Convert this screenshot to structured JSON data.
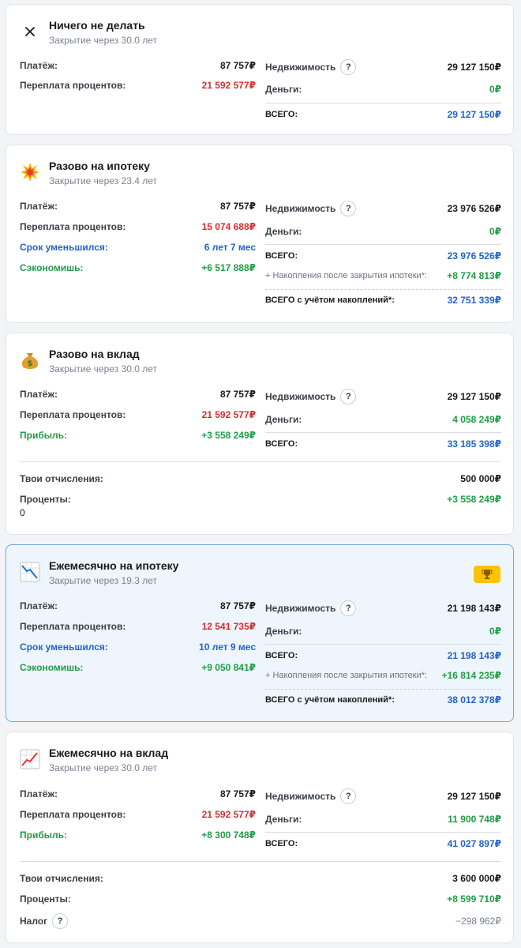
{
  "labels": {
    "payment": "Платёж:",
    "overpay": "Переплата процентов:",
    "term_reduced": "Срок уменьшился:",
    "saved": "Сэкономишь:",
    "profit": "Прибыль:",
    "realty": "Недвижимость",
    "money": "Деньги:",
    "total": "ВСЕГО:",
    "accum": "+ Накопления после закрытия ипотеки*:",
    "total_accum": "ВСЕГО с учётом накоплений*:",
    "contributions": "Твои отчисления:",
    "interest": "Проценты:",
    "tax": "Налог",
    "help": "?"
  },
  "cards": [
    {
      "title": "Ничего не делать",
      "subtitle": "Закрытие через 30.0 лет",
      "icon": "close-icon",
      "payment": "87 757₽",
      "overpay": "21 592 577₽",
      "realty": "29 127 150₽",
      "money": "0₽",
      "total": "29 127 150₽"
    },
    {
      "title": "Разово на ипотеку",
      "subtitle": "Закрытие через 23.4 лет",
      "icon": "explosion-icon",
      "payment": "87 757₽",
      "overpay": "15 074 688₽",
      "term_reduced": "6 лет 7 мес",
      "saved": "+6 517 888₽",
      "realty": "23 976 526₽",
      "money": "0₽",
      "total": "23 976 526₽",
      "accum": "+8 774 813₽",
      "total_accum": "32 751 339₽"
    },
    {
      "title": "Разово на вклад",
      "subtitle": "Закрытие через 30.0 лет",
      "icon": "money-bag-icon",
      "payment": "87 757₽",
      "overpay": "21 592 577₽",
      "profit": "+3 558 249₽",
      "realty": "29 127 150₽",
      "money": "4 058 249₽",
      "total": "33 185 398₽",
      "contributions": "500 000₽",
      "interest": "+3 558 249₽",
      "interest_note": "0"
    },
    {
      "title": "Ежемесячно на ипотеку",
      "subtitle": "Закрытие через 19.3 лет",
      "icon": "chart-decreasing-icon",
      "best": true,
      "payment": "87 757₽",
      "overpay": "12 541 735₽",
      "term_reduced": "10 лет 9 мес",
      "saved": "+9 050 841₽",
      "realty": "21 198 143₽",
      "money": "0₽",
      "total": "21 198 143₽",
      "accum": "+16 814 235₽",
      "total_accum": "38 012 378₽"
    },
    {
      "title": "Ежемесячно на вклад",
      "subtitle": "Закрытие через 30.0 лет",
      "icon": "chart-increasing-icon",
      "payment": "87 757₽",
      "overpay": "21 592 577₽",
      "profit": "+8 300 748₽",
      "realty": "29 127 150₽",
      "money": "11 900 748₽",
      "total": "41 027 897₽",
      "contributions": "3 600 000₽",
      "interest": "+8 599 710₽",
      "tax": "−298 962₽"
    }
  ],
  "colors": {
    "red": "#d32f2f",
    "green": "#1f9d45",
    "blue": "#2563c9",
    "best_bg": "#eef5fd",
    "best_border": "#6fa6de",
    "trophy": "#ffc200"
  }
}
